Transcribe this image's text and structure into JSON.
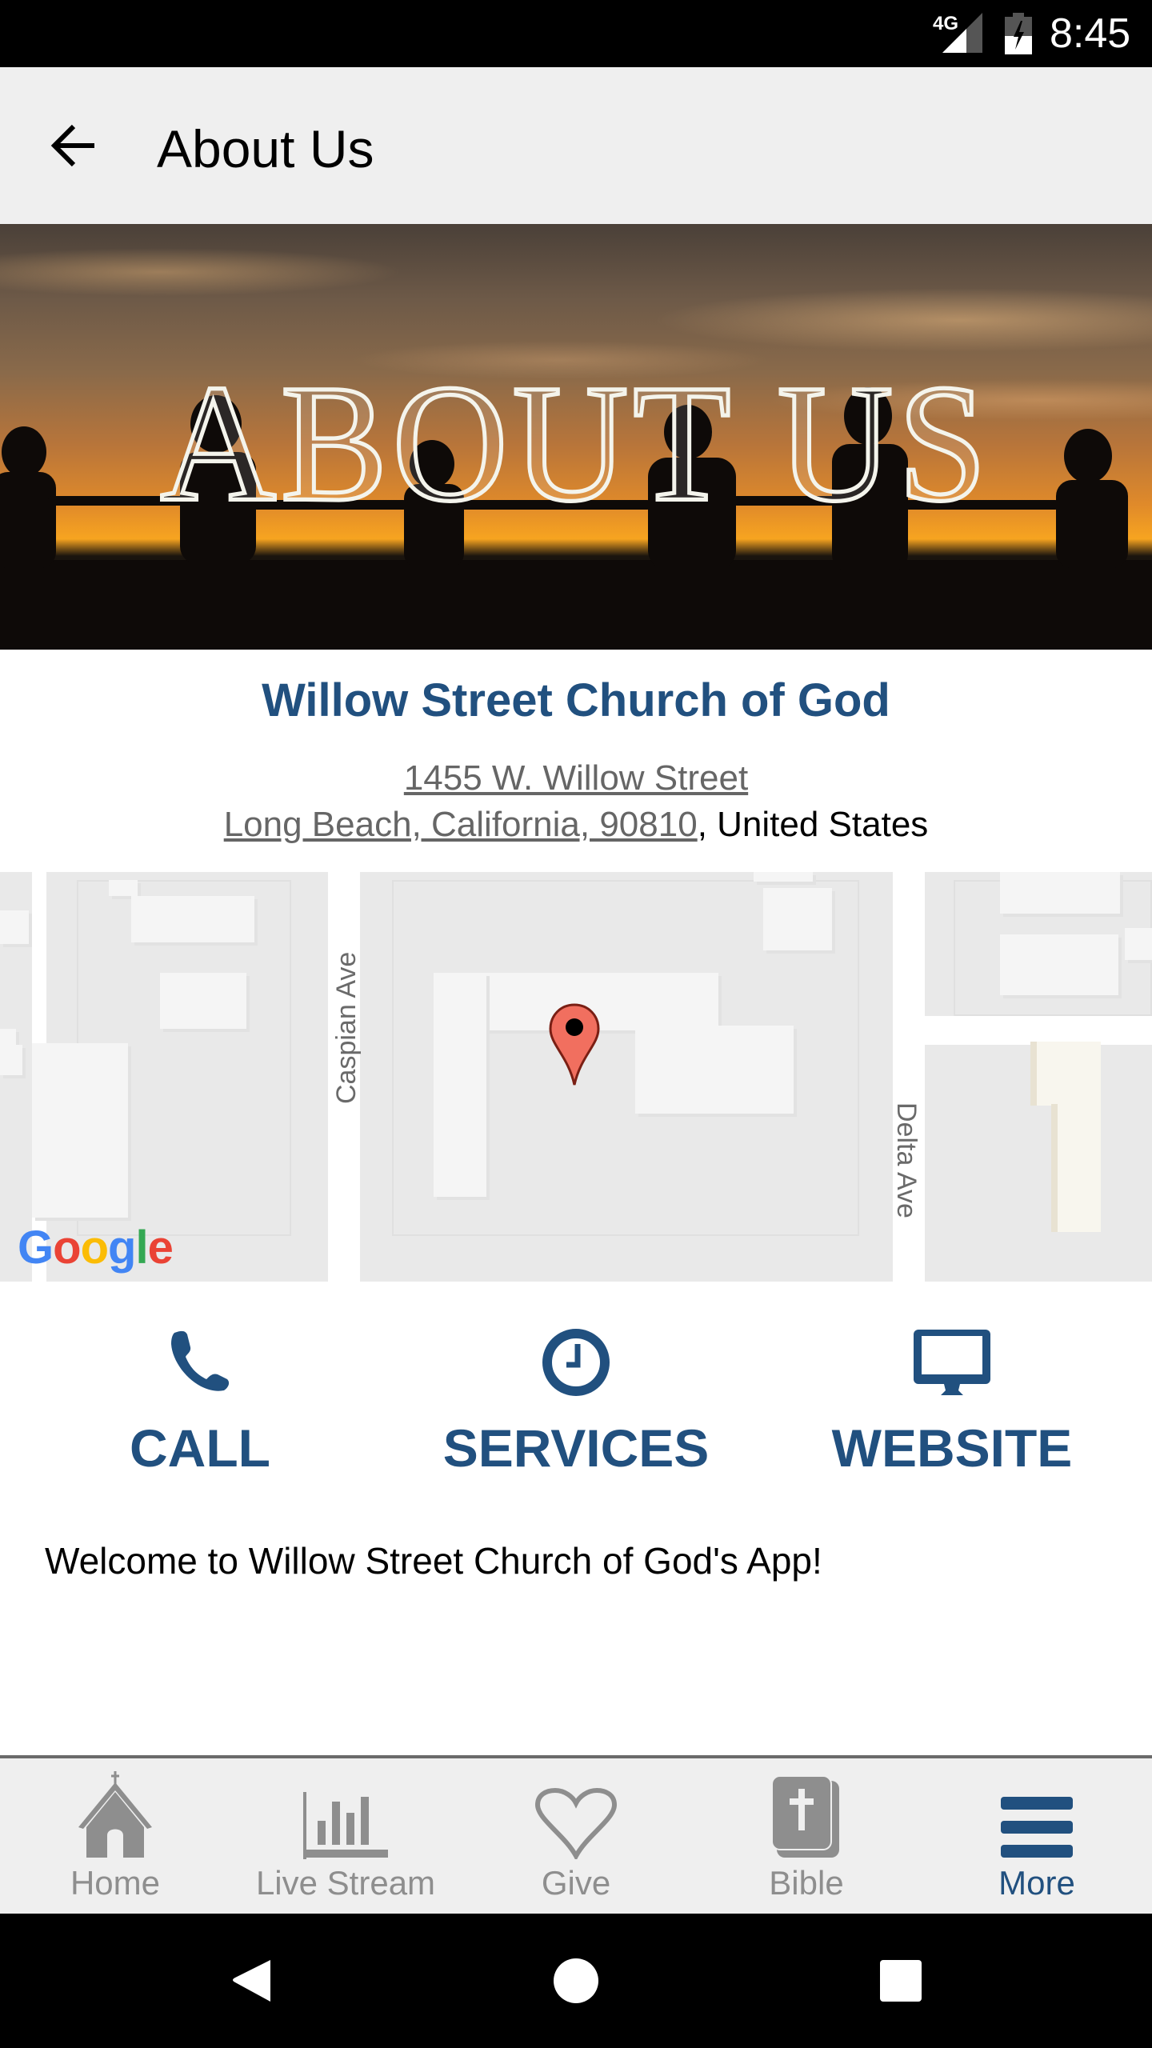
{
  "status_bar": {
    "network": "4G",
    "time": "8:45",
    "icons": [
      "signal-icon",
      "battery-charging-icon"
    ]
  },
  "app_bar": {
    "back_icon": "arrow-left-icon",
    "title": "About Us"
  },
  "banner": {
    "text": "About Us"
  },
  "church": {
    "name": "Willow Street Church of God",
    "address_line1": "1455 W. Willow Street",
    "address_line2": "Long Beach, California, 90810",
    "address_sep": ", ",
    "country": "United States"
  },
  "map": {
    "streets": [
      "Caspian Ave",
      "Delta Ave"
    ],
    "attribution": [
      "G",
      "o",
      "o",
      "g",
      "l",
      "e"
    ],
    "attribution_colors": [
      "#4285f4",
      "#ea4335",
      "#fbbc05",
      "#4285f4",
      "#34a853",
      "#ea4335"
    ],
    "pin_color": "#f16f5f"
  },
  "actions": [
    {
      "label": "CALL",
      "icon": "phone-icon"
    },
    {
      "label": "SERVICES",
      "icon": "clock-icon"
    },
    {
      "label": "WEBSITE",
      "icon": "monitor-icon"
    }
  ],
  "welcome_text": "Welcome to Willow Street Church of God's App!",
  "bottom_nav": {
    "items": [
      {
        "label": "Home",
        "icon": "church-icon",
        "active": false
      },
      {
        "label": "Live Stream",
        "icon": "bar-chart-icon",
        "active": false
      },
      {
        "label": "Give",
        "icon": "heart-icon",
        "active": false
      },
      {
        "label": "Bible",
        "icon": "bible-icon",
        "active": false
      },
      {
        "label": "More",
        "icon": "menu-icon",
        "active": true
      }
    ]
  },
  "colors": {
    "accent": "#21507f",
    "inactive": "#8e8e8e",
    "app_bar_bg": "#efefef"
  }
}
